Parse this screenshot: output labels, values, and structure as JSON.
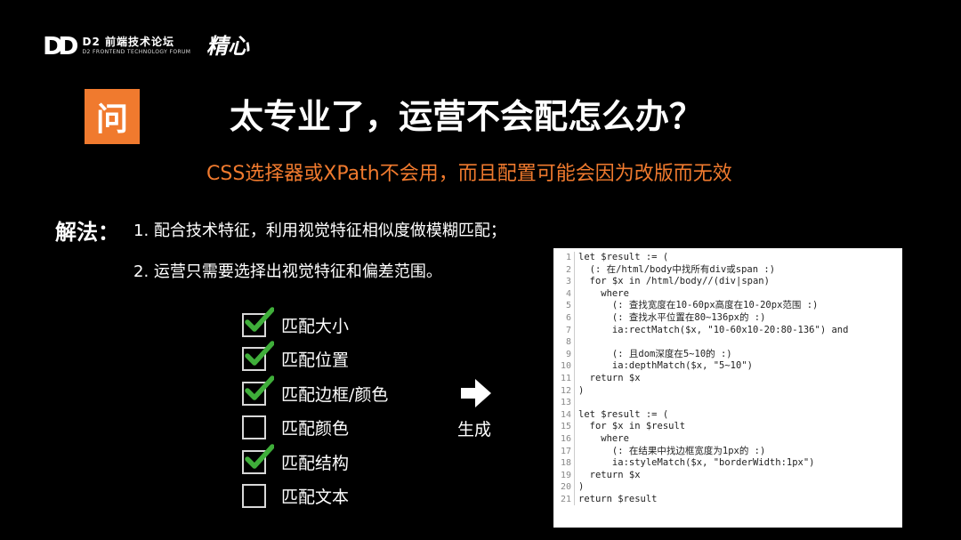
{
  "header": {
    "logo_mark": "DD",
    "logo_cn": "D2 前端技术论坛",
    "logo_en": "D2 FRONTEND TECHNOLOGY FORUM",
    "brush_text": "精心"
  },
  "question": {
    "badge": "问",
    "title": "太专业了，运营不会配怎么办？",
    "subtitle": "CSS选择器或XPath不会用，而且配置可能会因为改版而无效"
  },
  "solution": {
    "label": "解法：",
    "steps": [
      "1. 配合技术特征，利用视觉特征相似度做模糊匹配；",
      "2. 运营只需要选择出视觉特征和偏差范围。"
    ]
  },
  "checklist": [
    {
      "label": "匹配大小",
      "checked": true
    },
    {
      "label": "匹配位置",
      "checked": true
    },
    {
      "label": "匹配边框/颜色",
      "checked": true
    },
    {
      "label": "匹配颜色",
      "checked": false
    },
    {
      "label": "匹配结构",
      "checked": true
    },
    {
      "label": "匹配文本",
      "checked": false
    }
  ],
  "generate_label": "生成",
  "code_lines": [
    {
      "n": "1",
      "t": "let $result := ("
    },
    {
      "n": "2",
      "t": "  (: 在/html/body中找所有div或span :)"
    },
    {
      "n": "3",
      "t": "  for $x in /html/body//(div|span)"
    },
    {
      "n": "4",
      "t": "    where"
    },
    {
      "n": "5",
      "t": "      (: 查找宽度在10-60px高度在10-20px范围 :)"
    },
    {
      "n": "6",
      "t": "      (: 查找水平位置在80~136px的 :)"
    },
    {
      "n": "7",
      "t": "      ia:rectMatch($x, \"10-60x10-20:80-136\") and"
    },
    {
      "n": "8",
      "t": ""
    },
    {
      "n": "9",
      "t": "      (: 且dom深度在5~10的 :)"
    },
    {
      "n": "10",
      "t": "      ia:depthMatch($x, \"5~10\")"
    },
    {
      "n": "11",
      "t": "  return $x"
    },
    {
      "n": "12",
      "t": ")"
    },
    {
      "n": "13",
      "t": ""
    },
    {
      "n": "14",
      "t": "let $result := ("
    },
    {
      "n": "15",
      "t": "  for $x in $result"
    },
    {
      "n": "16",
      "t": "    where"
    },
    {
      "n": "17",
      "t": "      (: 在结果中找边框宽度为1px的 :)"
    },
    {
      "n": "18",
      "t": "      ia:styleMatch($x, \"borderWidth:1px\")"
    },
    {
      "n": "19",
      "t": "  return $x"
    },
    {
      "n": "20",
      "t": ")"
    },
    {
      "n": "21",
      "t": "return $result"
    }
  ],
  "colors": {
    "accent": "#f07a2e",
    "check_green": "#3fae3a",
    "background": "#000000"
  }
}
